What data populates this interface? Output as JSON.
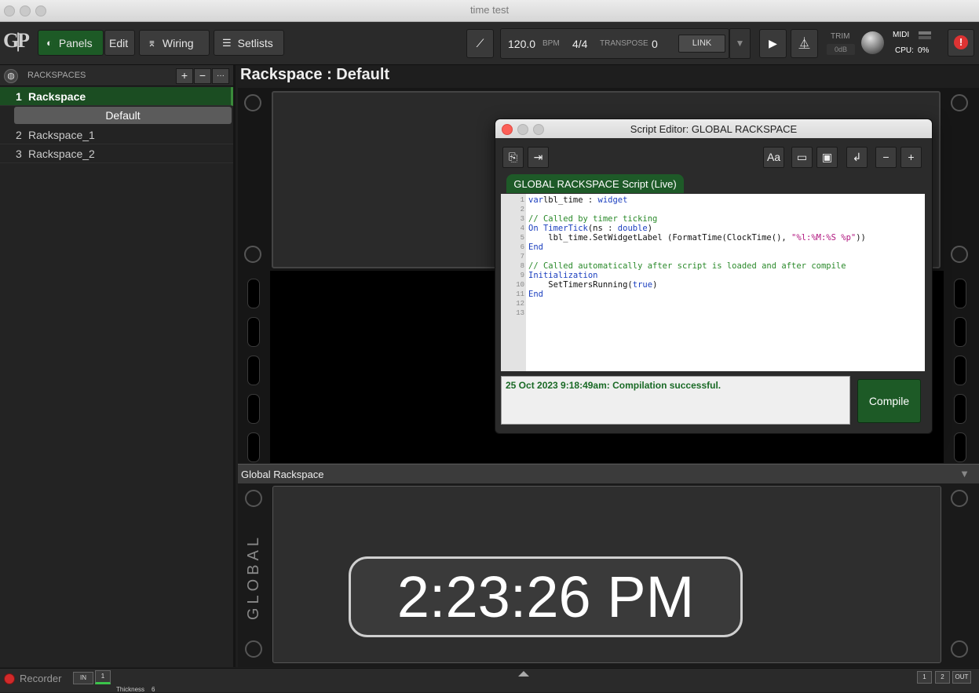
{
  "window": {
    "title": "time test"
  },
  "toolbar": {
    "panels_label": "Panels",
    "edit_label": "Edit",
    "wiring_label": "Wiring",
    "setlists_label": "Setlists",
    "bpm_value": "120.0",
    "bpm_unit": "BPM",
    "time_signature": "4/4",
    "transpose_label": "TRANSPOSE",
    "transpose_value": "0",
    "link_label": "LINK",
    "trim_label": "TRIM",
    "trim_value": "0dB",
    "midi_label": "MIDI",
    "cpu_label": "CPU:",
    "cpu_value": "0%"
  },
  "sidebar": {
    "header": "RACKSPACES",
    "items": [
      {
        "num": "1",
        "label": "Rackspace",
        "selected": true
      },
      {
        "num": "2",
        "label": "Rackspace_1",
        "selected": false
      },
      {
        "num": "3",
        "label": "Rackspace_2",
        "selected": false
      }
    ],
    "variation": "Default"
  },
  "main": {
    "rackspace_title": "Rackspace : Default",
    "global_bar_label": "Global Rackspace",
    "global_side_label": "GLOBAL",
    "clock_text": "2:23:26 PM"
  },
  "editor": {
    "title": "Script Editor:  GLOBAL RACKSPACE",
    "tab_label": "GLOBAL RACKSPACE Script (Live)",
    "line_numbers": [
      "1",
      "2",
      "3",
      "4",
      "5",
      "6",
      "7",
      "8",
      "9",
      "10",
      "11",
      "12",
      "13"
    ],
    "status_message": "25 Oct 2023 9:18:49am: Compilation successful.",
    "compile_label": "Compile"
  },
  "bottom": {
    "recorder_label": "Recorder",
    "in_label": "IN",
    "in_num": "1",
    "out_num_1": "1",
    "out_num_2": "2",
    "out_label": "OUT",
    "thickness_label": "Thickness",
    "thickness_value": "6"
  }
}
